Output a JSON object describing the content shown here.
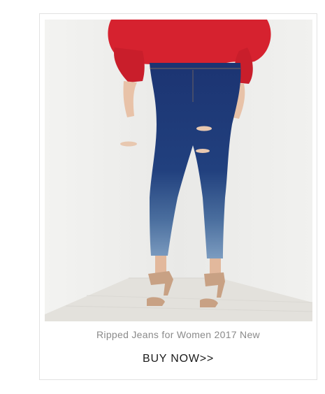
{
  "product": {
    "caption": "Ripped Jeans for Women 2017 New",
    "cta_label": "BUY NOW>>"
  },
  "colors": {
    "top": "#d6222f",
    "denim_dark": "#1e3a78",
    "denim_light": "#6d8fb4",
    "heels": "#c8a184",
    "wall": "#ededeb",
    "floor": "#e4e2de"
  }
}
